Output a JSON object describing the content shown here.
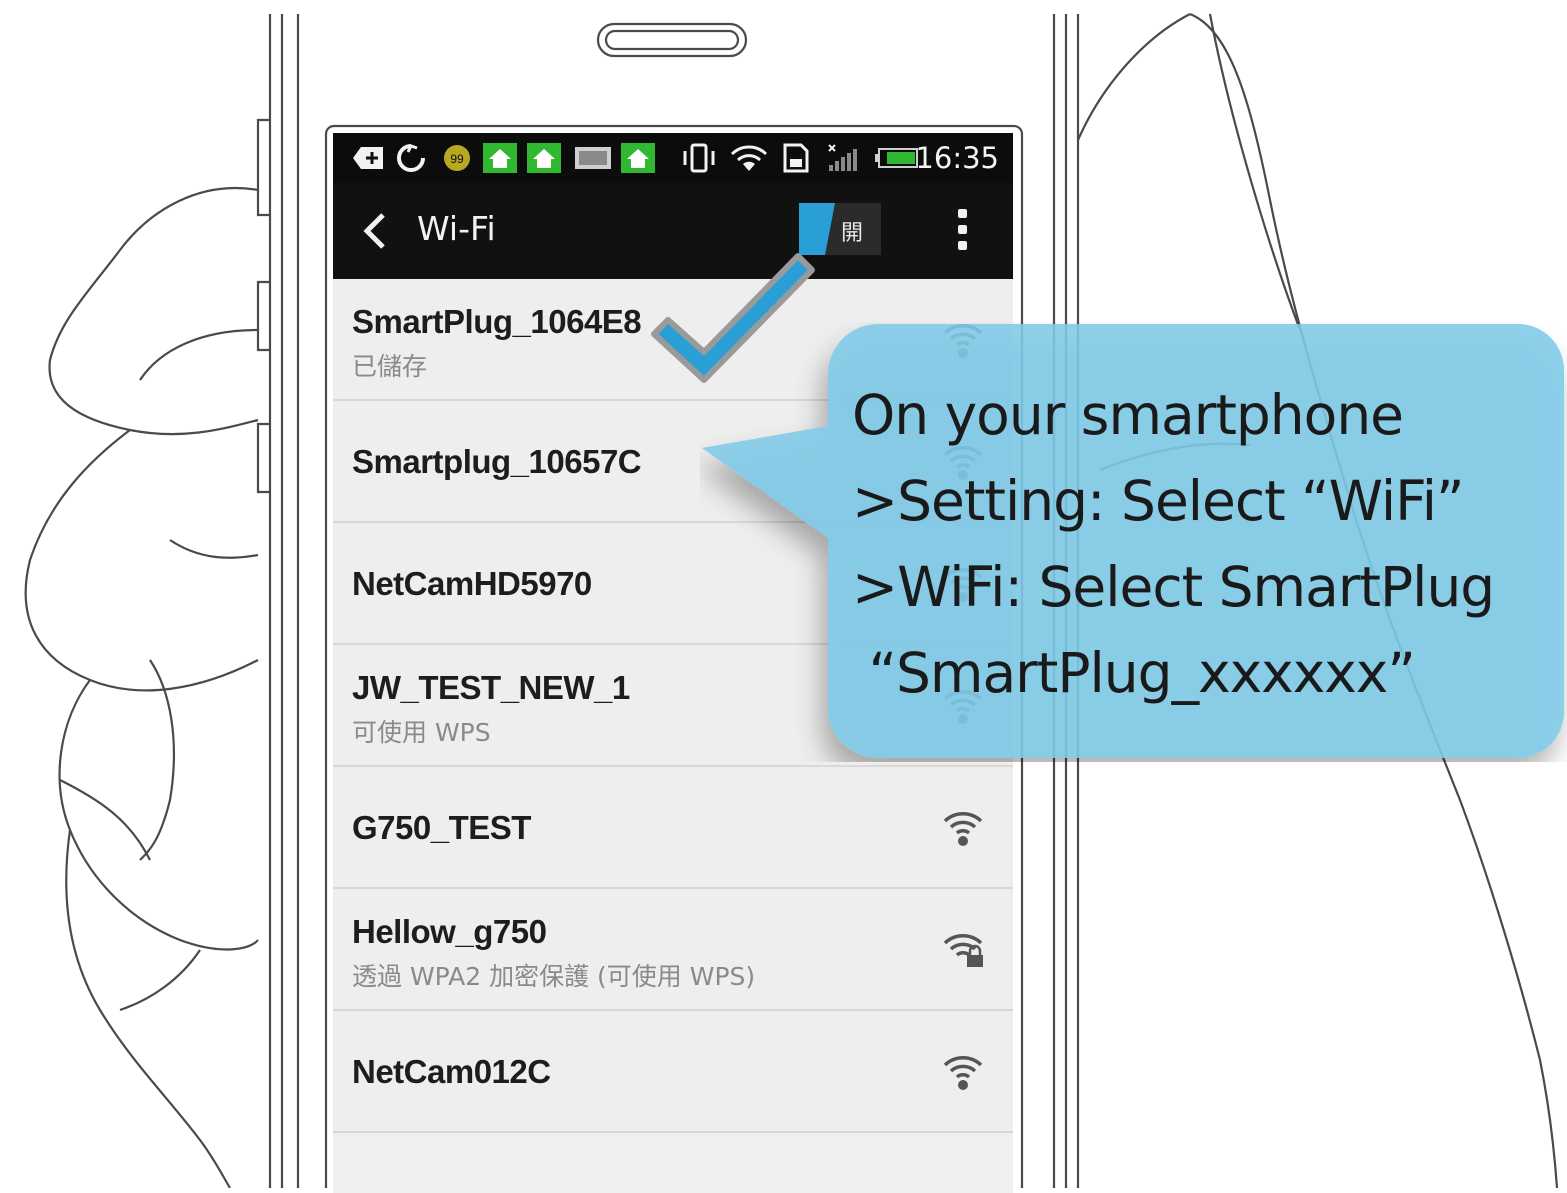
{
  "status_bar": {
    "time": "16:35",
    "notification_count": "99",
    "icons": [
      "plus-icon",
      "sync-icon",
      "badge-99-icon",
      "home-icon",
      "home-icon",
      "image-icon",
      "home-icon",
      "vibrate-icon",
      "wifi-icon",
      "sim-icon",
      "signal-icon",
      "battery-icon"
    ]
  },
  "action_bar": {
    "title": "Wi-Fi",
    "toggle_label": "開",
    "back_icon": "chevron-left-icon",
    "menu_icon": "overflow-menu-icon"
  },
  "networks": [
    {
      "name": "SmartPlug_1064E8",
      "subtitle": "已儲存",
      "icon": "wifi-signal-icon"
    },
    {
      "name": "Smartplug_10657C",
      "subtitle": "",
      "icon": "wifi-signal-icon"
    },
    {
      "name": "NetCamHD5970",
      "subtitle": "",
      "icon": "wifi-signal-icon"
    },
    {
      "name": "JW_TEST_NEW_1",
      "subtitle": "可使用 WPS",
      "icon": "wifi-signal-icon"
    },
    {
      "name": "G750_TEST",
      "subtitle": "",
      "icon": "wifi-signal-icon"
    },
    {
      "name": "Hellow_g750",
      "subtitle": "透過 WPA2 加密保護 (可使用 WPS)",
      "icon": "wifi-lock-icon"
    },
    {
      "name": "NetCam012C",
      "subtitle": "",
      "icon": "wifi-signal-icon"
    }
  ],
  "callout": {
    "text": "On your smartphone\n>Setting: Select “WiFi”\n>WiFi: Select SmartPlug\n “SmartPlug_xxxxxx”",
    "color": "#7fcbe8"
  },
  "colors": {
    "accent_blue": "#2a9fd6",
    "callout_blue": "#7fcbe8",
    "status_green": "#2fb830"
  }
}
